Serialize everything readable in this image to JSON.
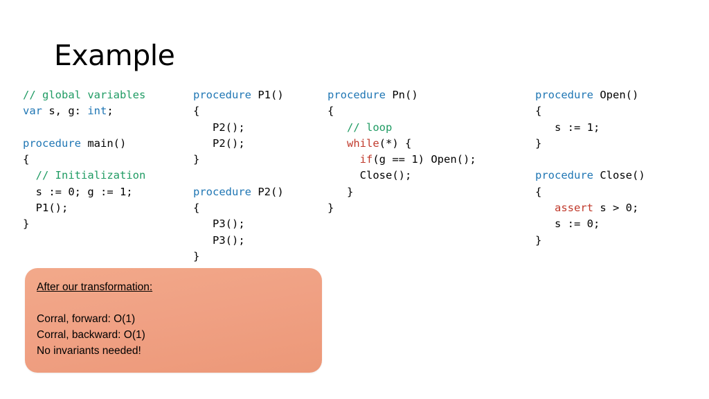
{
  "slide": {
    "title": "Example",
    "columns": [
      {
        "name": "main-column",
        "lines": [
          [
            {
              "t": "// global variables",
              "c": "cmt"
            }
          ],
          [
            {
              "t": "var",
              "c": "kw"
            },
            {
              "t": " s, g: ",
              "c": ""
            },
            {
              "t": "int",
              "c": "kw"
            },
            {
              "t": ";",
              "c": ""
            }
          ],
          [
            {
              "t": "",
              "c": ""
            }
          ],
          [
            {
              "t": "procedure",
              "c": "kw"
            },
            {
              "t": " main()",
              "c": ""
            }
          ],
          [
            {
              "t": "{",
              "c": ""
            }
          ],
          [
            {
              "t": "  ",
              "c": ""
            },
            {
              "t": "// Initialization",
              "c": "cmt"
            }
          ],
          [
            {
              "t": "  s := 0; g := 1;",
              "c": ""
            }
          ],
          [
            {
              "t": "  P1();",
              "c": ""
            }
          ],
          [
            {
              "t": "}",
              "c": ""
            }
          ]
        ]
      },
      {
        "name": "p1-p2-column",
        "lines": [
          [
            {
              "t": "procedure",
              "c": "kw"
            },
            {
              "t": " P1()",
              "c": ""
            }
          ],
          [
            {
              "t": "{",
              "c": ""
            }
          ],
          [
            {
              "t": "   P2();",
              "c": ""
            }
          ],
          [
            {
              "t": "   P2();",
              "c": ""
            }
          ],
          [
            {
              "t": "}",
              "c": ""
            }
          ],
          [
            {
              "t": "",
              "c": ""
            }
          ],
          [
            {
              "t": "procedure",
              "c": "kw"
            },
            {
              "t": " P2()",
              "c": ""
            }
          ],
          [
            {
              "t": "{",
              "c": ""
            }
          ],
          [
            {
              "t": "   P3();",
              "c": ""
            }
          ],
          [
            {
              "t": "   P3();",
              "c": ""
            }
          ],
          [
            {
              "t": "}",
              "c": ""
            }
          ]
        ]
      },
      {
        "name": "pn-column",
        "lines": [
          [
            {
              "t": "procedure",
              "c": "kw"
            },
            {
              "t": " Pn()",
              "c": ""
            }
          ],
          [
            {
              "t": "{",
              "c": ""
            }
          ],
          [
            {
              "t": "   ",
              "c": ""
            },
            {
              "t": "// loop",
              "c": "cmt"
            }
          ],
          [
            {
              "t": "   ",
              "c": ""
            },
            {
              "t": "while",
              "c": "ctrl"
            },
            {
              "t": "(*) {",
              "c": ""
            }
          ],
          [
            {
              "t": "     ",
              "c": ""
            },
            {
              "t": "if",
              "c": "ctrl"
            },
            {
              "t": "(g == 1) Open();",
              "c": ""
            }
          ],
          [
            {
              "t": "     Close();",
              "c": ""
            }
          ],
          [
            {
              "t": "   }",
              "c": ""
            }
          ],
          [
            {
              "t": "}",
              "c": ""
            }
          ]
        ]
      },
      {
        "name": "open-close-column",
        "lines": [
          [
            {
              "t": "procedure",
              "c": "kw"
            },
            {
              "t": " Open()",
              "c": ""
            }
          ],
          [
            {
              "t": "{",
              "c": ""
            }
          ],
          [
            {
              "t": "   s := 1;",
              "c": ""
            }
          ],
          [
            {
              "t": "}",
              "c": ""
            }
          ],
          [
            {
              "t": "",
              "c": ""
            }
          ],
          [
            {
              "t": "procedure",
              "c": "kw"
            },
            {
              "t": " Close()",
              "c": ""
            }
          ],
          [
            {
              "t": "{",
              "c": ""
            }
          ],
          [
            {
              "t": "   ",
              "c": ""
            },
            {
              "t": "assert",
              "c": "assertkw"
            },
            {
              "t": " s > 0;",
              "c": ""
            }
          ],
          [
            {
              "t": "   s := 0;",
              "c": ""
            }
          ],
          [
            {
              "t": "}",
              "c": ""
            }
          ]
        ]
      }
    ],
    "note": {
      "heading": "After our transformation:",
      "lines": [
        "Corral, forward: O(1)",
        "Corral, backward: O(1)",
        "No invariants needed!"
      ]
    }
  },
  "colors": {
    "keyword": "#1f76b4",
    "comment": "#1f9b63",
    "control": "#c0392b",
    "note_bg": "#f0a184"
  }
}
